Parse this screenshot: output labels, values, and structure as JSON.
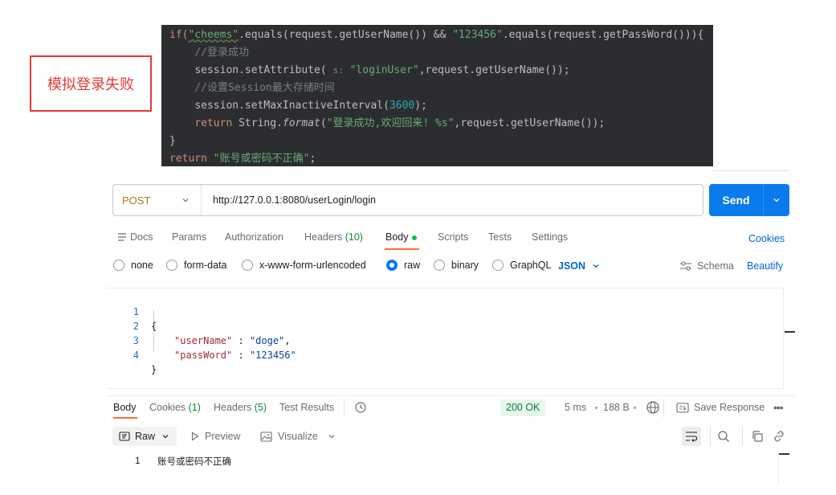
{
  "annotation": {
    "label": "模拟登录失败"
  },
  "code": {
    "l1_a": "if(",
    "l1_s1": "\"cheems\"",
    "l1_b": ".equals(request.getUserName()) && ",
    "l1_s2": "\"123456\"",
    "l1_c": ".equals(request.getPassWord())){",
    "l2": "//登录成功",
    "l3_a": "session.setAttribute(",
    "l3_hint": "s:",
    "l3_s": "\"loginUser\"",
    "l3_b": ",request.getUserName());",
    "l4": "//设置Session最大存储时间",
    "l5_a": "session.setMaxInactiveInterval(",
    "l5_n": "3600",
    "l5_b": ");",
    "l6_kw": "return",
    "l6_a": " String.",
    "l6_it": "format",
    "l6_b": "(",
    "l6_s": "\"登录成功,欢迎回来! %s\"",
    "l6_c": ",request.getUserName());",
    "l7": "}",
    "l8_kw": "return",
    "l8_s": "\"账号或密码不正确\"",
    "l8_b": ";"
  },
  "request": {
    "method": "POST",
    "url": "http://127.0.0.1:8080/userLogin/login",
    "send_label": "Send"
  },
  "tabs": {
    "docs": "Docs",
    "params": "Params",
    "authorization": "Authorization",
    "headers": "Headers",
    "headers_count": "(10)",
    "body": "Body",
    "scripts": "Scripts",
    "tests": "Tests",
    "settings": "Settings",
    "cookies": "Cookies"
  },
  "body_types": {
    "none": "none",
    "form_data": "form-data",
    "urlencoded": "x-www-form-urlencoded",
    "raw": "raw",
    "binary": "binary",
    "graphql": "GraphQL",
    "format": "JSON",
    "schema": "Schema",
    "beautify": "Beautify"
  },
  "editor": {
    "lines": [
      "1",
      "2",
      "3",
      "4"
    ],
    "open": "{",
    "key1": "\"userName\"",
    "sep": " : ",
    "val1": "\"doge\"",
    "comma": ",",
    "key2": "\"passWord\"",
    "val2": "\"123456\"",
    "close": "}"
  },
  "response": {
    "tabs": {
      "body": "Body",
      "cookies": "Cookies",
      "cookies_count": "(1)",
      "headers": "Headers",
      "headers_count": "(5)",
      "test_results": "Test Results"
    },
    "status": "200 OK",
    "time": "5 ms",
    "size": "188 B",
    "save": "Save Response",
    "view_raw": "Raw",
    "preview": "Preview",
    "visualize": "Visualize",
    "line_no": "1",
    "body_text": "账号或密码不正确"
  }
}
